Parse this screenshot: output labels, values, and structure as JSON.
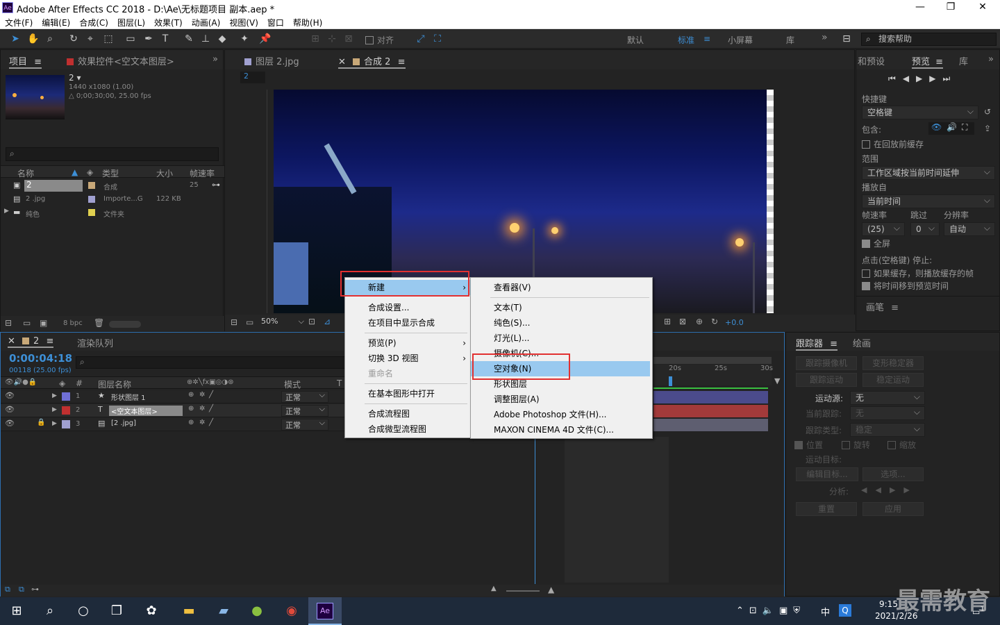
{
  "window": {
    "app_logo": "Ae",
    "title": "Adobe After Effects CC 2018 - D:\\Ae\\无标题项目 副本.aep *",
    "min": "—",
    "max": "❐",
    "close": "✕"
  },
  "menubar": [
    "文件(F)",
    "编辑(E)",
    "合成(C)",
    "图层(L)",
    "效果(T)",
    "动画(A)",
    "视图(V)",
    "窗口",
    "帮助(H)"
  ],
  "toolbar": {
    "snap_label": "对齐",
    "workspaces": [
      "默认",
      "标准",
      "小屏幕",
      "库"
    ],
    "active_workspace": "标准",
    "expand": "»",
    "search_placeholder": "搜索帮助"
  },
  "project_panel": {
    "tab_project": "项目",
    "tab_effects": "效果控件<空文本图层>",
    "expand": "»",
    "comp_name": "2",
    "comp_res": "1440 x1080 (1.00)",
    "comp_dur": "△ 0;00;30;00, 25.00 fps",
    "columns": [
      "名称",
      "类型",
      "大小",
      "帧速率"
    ],
    "items": [
      {
        "name": "2",
        "type": "合成",
        "size": "",
        "fps": "25"
      },
      {
        "name": "2 .jpg",
        "type": "Importe...G",
        "size": "122 KB",
        "fps": ""
      },
      {
        "name": "纯色",
        "type": "文件夹",
        "size": "",
        "fps": ""
      }
    ],
    "bpc": "8 bpc"
  },
  "viewer": {
    "tab_layer": "图层 2.jpg",
    "tab_comp": "合成 2",
    "comp_chip": "2",
    "zoom": "50%",
    "exposure": "+0.0"
  },
  "right_panel": {
    "tab_presets": "和预设",
    "tab_preview": "预览",
    "tab_lib": "库",
    "expand": "»",
    "shortcut_label": "快捷键",
    "shortcut_value": "空格键",
    "include_label": "包含:",
    "cache_before": "在回放前缓存",
    "range_label": "范围",
    "range_value": "工作区域按当前时间延伸",
    "play_from_label": "播放自",
    "play_from_value": "当前时间",
    "fps_label": "帧速率",
    "skip_label": "跳过",
    "res_label": "分辨率",
    "fps_value": "(25)",
    "skip_value": "0",
    "res_value": "自动",
    "fullscreen": "全屏",
    "stop_label": "点击(空格键) 停止:",
    "stop_opt1": "如果缓存，则播放缓存的帧",
    "stop_opt2": "将时间移到预览时间",
    "brush_tab": "画笔"
  },
  "timeline": {
    "tab_comp": "2",
    "tab_render": "渲染队列",
    "timecode": "0:00:04:18",
    "frame_info": "00118 (25.00 fps)",
    "col_layer_name": "图层名称",
    "col_mode": "模式",
    "col_t": "T",
    "layers": [
      {
        "num": "1",
        "name": "形状图层 1",
        "color": "#6f6fd6",
        "mode": "正常"
      },
      {
        "num": "2",
        "name": "<空文本图层>",
        "color": "#c03030",
        "mode": "正常"
      },
      {
        "num": "3",
        "name": "[2 .jpg]",
        "color": "#a0a0d0",
        "mode": "正常"
      }
    ],
    "ruler": [
      "20s",
      "25s",
      "30s"
    ]
  },
  "tracker": {
    "tab_tracker": "跟踪器",
    "tab_paint": "绘画",
    "btn_track_camera": "跟踪摄像机",
    "btn_warp": "变形稳定器",
    "btn_track_motion": "跟踪运动",
    "btn_stabilize": "稳定运动",
    "motion_source_label": "运动源:",
    "motion_source_value": "无",
    "current_track_label": "当前跟踪:",
    "current_track_value": "无",
    "track_type_label": "跟踪类型:",
    "track_type_value": "稳定",
    "chk_position": "位置",
    "chk_rotation": "旋转",
    "chk_scale": "缩放",
    "motion_target_label": "运动目标:",
    "btn_edit_target": "编辑目标...",
    "btn_options": "选项...",
    "analyze_label": "分析:",
    "btn_reset": "重置",
    "btn_apply": "应用"
  },
  "context_menu": {
    "items": [
      {
        "label": "新建",
        "submenu": true,
        "highlight": true
      },
      {
        "label": "合成设置..."
      },
      {
        "label": "在项目中显示合成"
      },
      {
        "label": "预览(P)",
        "submenu": true
      },
      {
        "label": "切换 3D 视图",
        "submenu": true
      },
      {
        "label": "重命名",
        "disabled": true
      },
      {
        "label": "在基本图形中打开"
      },
      {
        "label": "合成流程图"
      },
      {
        "label": "合成微型流程图"
      }
    ],
    "arrow": "›"
  },
  "submenu": {
    "items": [
      "查看器(V)",
      "文本(T)",
      "纯色(S)...",
      "灯光(L)...",
      "摄像机(C)...",
      "空对象(N)",
      "形状图层",
      "调整图层(A)",
      "Adobe Photoshop 文件(H)...",
      "MAXON CINEMA 4D 文件(C)..."
    ],
    "highlight": "空对象(N)"
  },
  "taskbar": {
    "time": "9:15",
    "date": "2021/2/26",
    "ime": "中",
    "notify": "1"
  },
  "watermark": "最需教育"
}
